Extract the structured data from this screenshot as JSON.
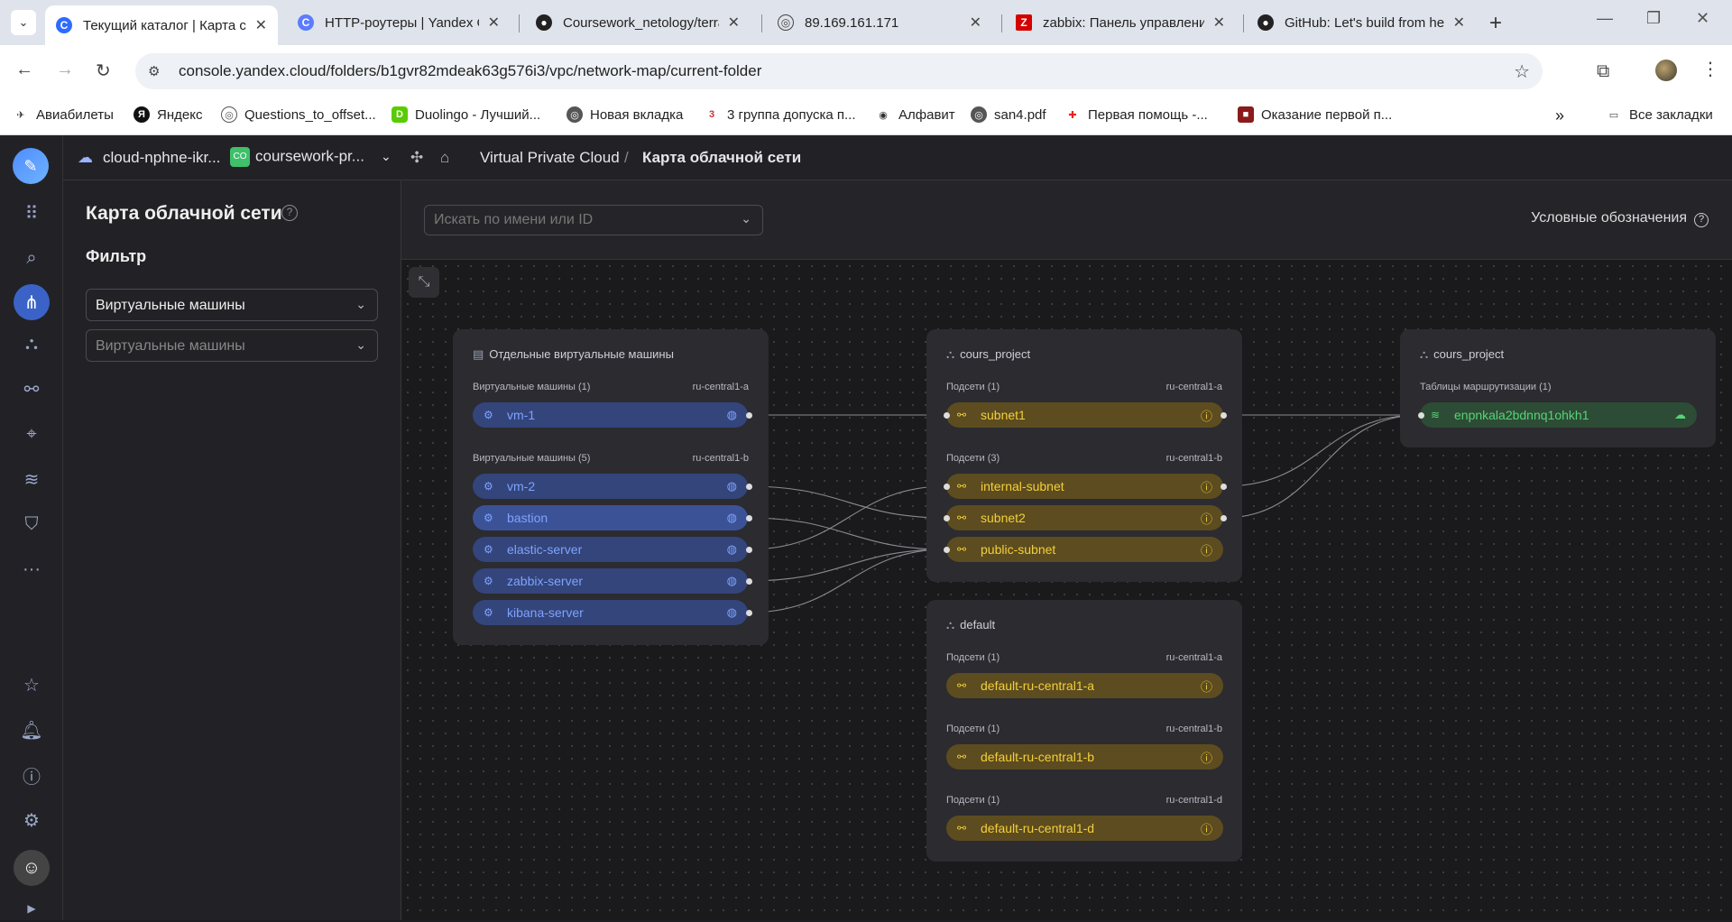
{
  "browser": {
    "tabs": [
      {
        "title": "Текущий каталог | Карта с",
        "active": true
      },
      {
        "title": "HTTP-роутеры | Yandex Cl"
      },
      {
        "title": "Coursework_netology/terra"
      },
      {
        "title": "89.169.161.171"
      },
      {
        "title": "zabbix: Панель управлени"
      },
      {
        "title": "GitHub: Let's build from he"
      }
    ],
    "url": "console.yandex.cloud/folders/b1gvr82mdeak63g576i3/vpc/network-map/current-folder",
    "bookmarks": [
      "Авиабилеты",
      "Яндекс",
      "Questions_to_offset...",
      "Duolingo - Лучший...",
      "Новая вкладка",
      "3 группа допуска п...",
      "Алфавит",
      "san4.pdf",
      "Первая помощь -...",
      "Оказание первой п..."
    ],
    "all_bookmarks": "Все закладки"
  },
  "topbar": {
    "cloud": "cloud-nphne-ikr...",
    "folder_badge": "CO",
    "folder": "coursework-pr...",
    "service": "Virtual Private Cloud",
    "separator": "/",
    "page": "Карта облачной сети"
  },
  "sidepanel": {
    "title": "Карта облачной сети",
    "help": "?",
    "filter_label": "Фильтр",
    "select1": "Виртуальные машины",
    "select2_placeholder": "Виртуальные машины"
  },
  "map": {
    "search_placeholder": "Искать по имени или ID",
    "legend": "Условные обозначения",
    "groups": {
      "standalone": {
        "title": "Отдельные виртуальные машины",
        "sec_a_label": "Виртуальные машины (1)",
        "sec_a_zone": "ru-central1-a",
        "sec_b_label": "Виртуальные машины (5)",
        "sec_b_zone": "ru-central1-b",
        "vms": [
          "vm-1",
          "vm-2",
          "bastion",
          "elastic-server",
          "zabbix-server",
          "kibana-server"
        ]
      },
      "cours": {
        "title": "cours_project",
        "sec_a_label": "Подсети (1)",
        "sec_a_zone": "ru-central1-a",
        "sec_b_label": "Подсети (3)",
        "sec_b_zone": "ru-central1-b",
        "subnets": [
          "subnet1",
          "internal-subnet",
          "subnet2",
          "public-subnet"
        ]
      },
      "default": {
        "title": "default",
        "sec_a_label": "Подсети (1)",
        "sec_a_zone": "ru-central1-a",
        "sec_b_label": "Подсети (1)",
        "sec_b_zone": "ru-central1-b",
        "sec_d_label": "Подсети (1)",
        "sec_d_zone": "ru-central1-d",
        "subnets": [
          "default-ru-central1-a",
          "default-ru-central1-b",
          "default-ru-central1-d"
        ]
      },
      "routes": {
        "title": "cours_project",
        "sec_label": "Таблицы маршрутизации (1)",
        "table": "enpnkala2bdnnq1ohkh1"
      }
    }
  },
  "colors": {
    "vm_pill": "#33457a",
    "vm_text": "#7fa2ff",
    "subnet_pill": "#5c4c1f",
    "subnet_text": "#f4cf3a",
    "route_pill": "#2d4c35",
    "route_text": "#58d27a",
    "rail_active": "#3b63c7"
  },
  "icons": [
    "chevron-down-icon",
    "refresh-icon",
    "back-icon",
    "forward-icon",
    "star-icon",
    "extensions-icon",
    "menu-icon",
    "grid-icon",
    "search-icon",
    "network-icon",
    "location-icon",
    "shield-icon",
    "bell-icon",
    "help-icon",
    "gear-icon",
    "vm-icon",
    "subnet-icon",
    "warning-icon",
    "cloud-icon",
    "route-icon"
  ]
}
